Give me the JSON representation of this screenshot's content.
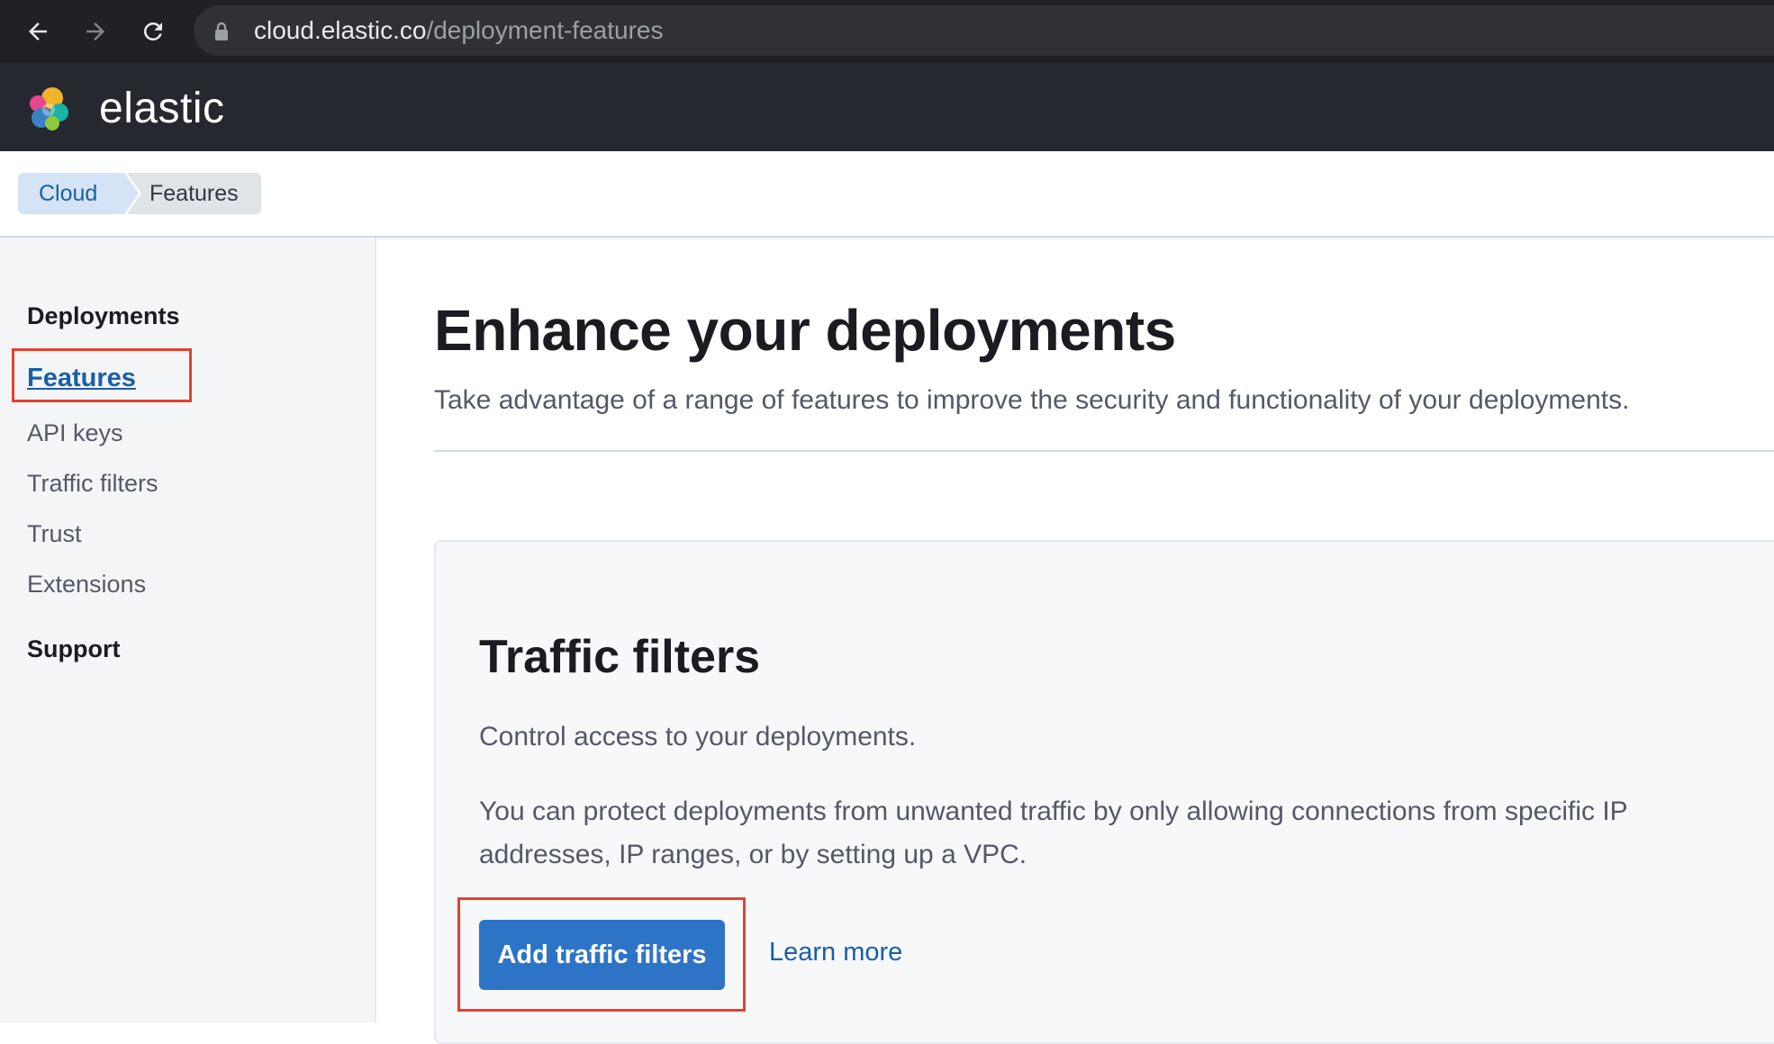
{
  "browser": {
    "url_host": "cloud.elastic.co",
    "url_path": "/deployment-features"
  },
  "header": {
    "brand": "elastic"
  },
  "breadcrumbs": [
    {
      "label": "Cloud"
    },
    {
      "label": "Features"
    }
  ],
  "sidebar": {
    "section_deployments": "Deployments",
    "items": [
      {
        "label": "Features",
        "active": true
      },
      {
        "label": "API keys"
      },
      {
        "label": "Traffic filters"
      },
      {
        "label": "Trust"
      },
      {
        "label": "Extensions"
      }
    ],
    "section_support": "Support"
  },
  "main": {
    "title": "Enhance your deployments",
    "subtitle": "Take advantage of a range of features to improve the security and functionality of your deployments."
  },
  "card": {
    "title": "Traffic filters",
    "description": "Control access to your deployments.",
    "body": "You can protect deployments from unwanted traffic by only allowing connections from specific IP addresses, IP ranges, or by setting up a VPC.",
    "primary_button": "Add traffic filters",
    "learn_more": "Learn more"
  },
  "colors": {
    "accent": "#2e74c6",
    "link": "#1a5fa8",
    "highlight": "#e2422f"
  }
}
